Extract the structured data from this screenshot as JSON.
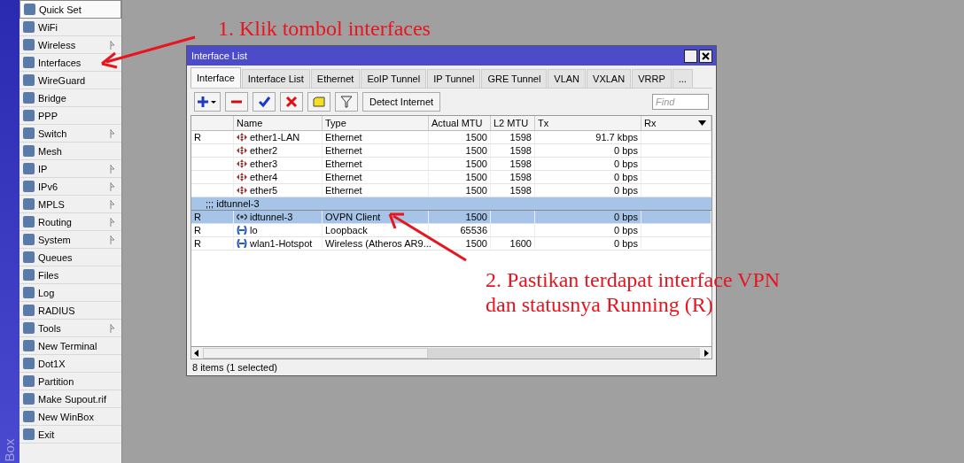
{
  "side_strip": {
    "label": "Box"
  },
  "menu": [
    {
      "label": "Quick Set",
      "submenu": false,
      "selected": true
    },
    {
      "label": "WiFi",
      "submenu": false,
      "selected": false
    },
    {
      "label": "Wireless",
      "submenu": true,
      "selected": false
    },
    {
      "label": "Interfaces",
      "submenu": false,
      "selected": false
    },
    {
      "label": "WireGuard",
      "submenu": false,
      "selected": false
    },
    {
      "label": "Bridge",
      "submenu": false,
      "selected": false
    },
    {
      "label": "PPP",
      "submenu": false,
      "selected": false
    },
    {
      "label": "Switch",
      "submenu": true,
      "selected": false
    },
    {
      "label": "Mesh",
      "submenu": false,
      "selected": false
    },
    {
      "label": "IP",
      "submenu": true,
      "selected": false
    },
    {
      "label": "IPv6",
      "submenu": true,
      "selected": false
    },
    {
      "label": "MPLS",
      "submenu": true,
      "selected": false
    },
    {
      "label": "Routing",
      "submenu": true,
      "selected": false
    },
    {
      "label": "System",
      "submenu": true,
      "selected": false
    },
    {
      "label": "Queues",
      "submenu": false,
      "selected": false
    },
    {
      "label": "Files",
      "submenu": false,
      "selected": false
    },
    {
      "label": "Log",
      "submenu": false,
      "selected": false
    },
    {
      "label": "RADIUS",
      "submenu": false,
      "selected": false
    },
    {
      "label": "Tools",
      "submenu": true,
      "selected": false
    },
    {
      "label": "New Terminal",
      "submenu": false,
      "selected": false
    },
    {
      "label": "Dot1X",
      "submenu": false,
      "selected": false
    },
    {
      "label": "Partition",
      "submenu": false,
      "selected": false
    },
    {
      "label": "Make Supout.rif",
      "submenu": false,
      "selected": false
    },
    {
      "label": "New WinBox",
      "submenu": false,
      "selected": false
    },
    {
      "label": "Exit",
      "submenu": false,
      "selected": false
    }
  ],
  "window": {
    "title": "Interface List",
    "tabs": [
      {
        "label": "Interface",
        "selected": true
      },
      {
        "label": "Interface List",
        "selected": false
      },
      {
        "label": "Ethernet",
        "selected": false
      },
      {
        "label": "EoIP Tunnel",
        "selected": false
      },
      {
        "label": "IP Tunnel",
        "selected": false
      },
      {
        "label": "GRE Tunnel",
        "selected": false
      },
      {
        "label": "VLAN",
        "selected": false
      },
      {
        "label": "VXLAN",
        "selected": false
      },
      {
        "label": "VRRP",
        "selected": false
      },
      {
        "label": "...",
        "selected": false
      }
    ],
    "toolbar": {
      "detect_button": "Detect Internet",
      "find": {
        "placeholder": "Find"
      }
    },
    "table": {
      "columns": [
        "",
        "Name",
        "Type",
        "Actual MTU",
        "L2 MTU",
        "Tx",
        "Rx"
      ],
      "rows": [
        {
          "kind": "ethernet",
          "flag": "R",
          "name": "ether1-LAN",
          "type": "Ethernet",
          "actual_mtu": "1500",
          "l2_mtu": "1598",
          "tx": "91.7 kbps",
          "selected": false
        },
        {
          "kind": "ethernet",
          "flag": "",
          "name": "ether2",
          "type": "Ethernet",
          "actual_mtu": "1500",
          "l2_mtu": "1598",
          "tx": "0 bps",
          "selected": false
        },
        {
          "kind": "ethernet",
          "flag": "",
          "name": "ether3",
          "type": "Ethernet",
          "actual_mtu": "1500",
          "l2_mtu": "1598",
          "tx": "0 bps",
          "selected": false
        },
        {
          "kind": "ethernet",
          "flag": "",
          "name": "ether4",
          "type": "Ethernet",
          "actual_mtu": "1500",
          "l2_mtu": "1598",
          "tx": "0 bps",
          "selected": false
        },
        {
          "kind": "ethernet",
          "flag": "",
          "name": "ether5",
          "type": "Ethernet",
          "actual_mtu": "1500",
          "l2_mtu": "1598",
          "tx": "0 bps",
          "selected": false
        },
        {
          "kind": "comment",
          "text": ";;; idtunnel-3",
          "selected": true
        },
        {
          "kind": "tunnel",
          "flag": "R",
          "name": "idtunnel-3",
          "type": "OVPN Client",
          "actual_mtu": "1500",
          "l2_mtu": "",
          "tx": "0 bps",
          "selected": true
        },
        {
          "kind": "wireless",
          "flag": "R",
          "name": "lo",
          "type": "Loopback",
          "actual_mtu": "65536",
          "l2_mtu": "",
          "tx": "0 bps",
          "selected": false
        },
        {
          "kind": "wireless",
          "flag": "R",
          "name": "wlan1-Hotspot",
          "type": "Wireless (Atheros AR9...",
          "actual_mtu": "1500",
          "l2_mtu": "1600",
          "tx": "0 bps",
          "selected": false
        }
      ]
    },
    "status_bar": "8 items (1 selected)"
  },
  "annotations": [
    {
      "text": "1. Klik tombol interfaces"
    },
    {
      "text": "2. Pastikan terdapat interface VPN dan statusnya Running (R)"
    }
  ]
}
